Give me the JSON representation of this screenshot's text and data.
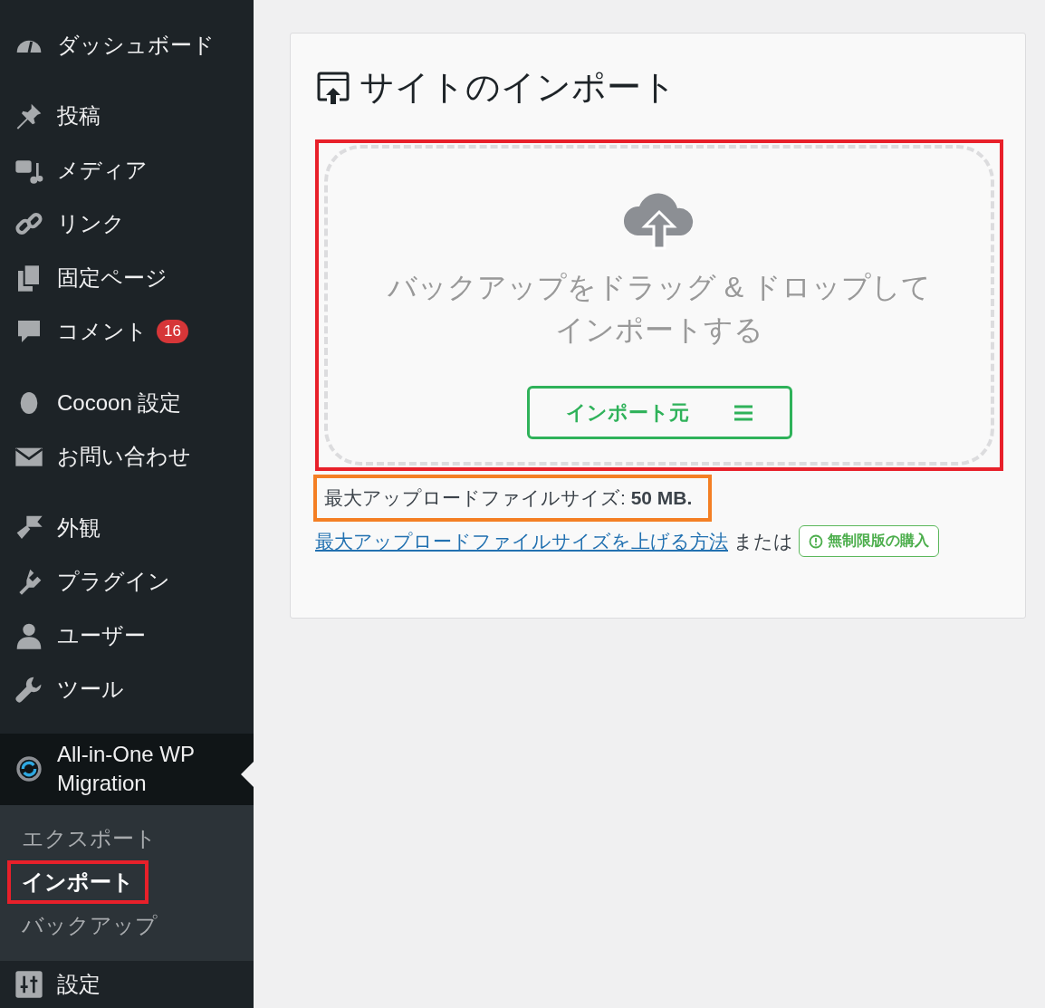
{
  "sidebar": {
    "groups": [
      [
        {
          "label": "ダッシュボード"
        }
      ],
      [
        {
          "label": "投稿"
        },
        {
          "label": "メディア"
        },
        {
          "label": "リンク"
        },
        {
          "label": "固定ページ"
        },
        {
          "label": "コメント",
          "badge": "16"
        }
      ],
      [
        {
          "label": "Cocoon 設定"
        },
        {
          "label": "お問い合わせ"
        }
      ],
      [
        {
          "label": "外観"
        },
        {
          "label": "プラグイン"
        },
        {
          "label": "ユーザー"
        },
        {
          "label": "ツール"
        }
      ]
    ],
    "active_item": {
      "label": "All-in-One WP Migration",
      "submenu": [
        {
          "label": "エクスポート",
          "selected": false,
          "highlighted": false
        },
        {
          "label": "インポート",
          "selected": true,
          "highlighted": true
        },
        {
          "label": "バックアップ",
          "selected": false,
          "highlighted": false
        }
      ]
    },
    "bottom_items": [
      {
        "label": "設定"
      }
    ]
  },
  "panel": {
    "title": "サイトのインポート",
    "dropzone": {
      "highlighted": true,
      "text_lines": [
        "バックアップをドラッグ & ドロップして",
        "インポートする"
      ],
      "button": "インポート元"
    },
    "max_size": {
      "text": "最大アップロードファイルサイズ: **50 MB.**",
      "highlighted": true
    },
    "help_link": "最大アップロードファイルサイズを上げる方法",
    "or_text": "または",
    "purchase_button": "無制限版の購入"
  }
}
